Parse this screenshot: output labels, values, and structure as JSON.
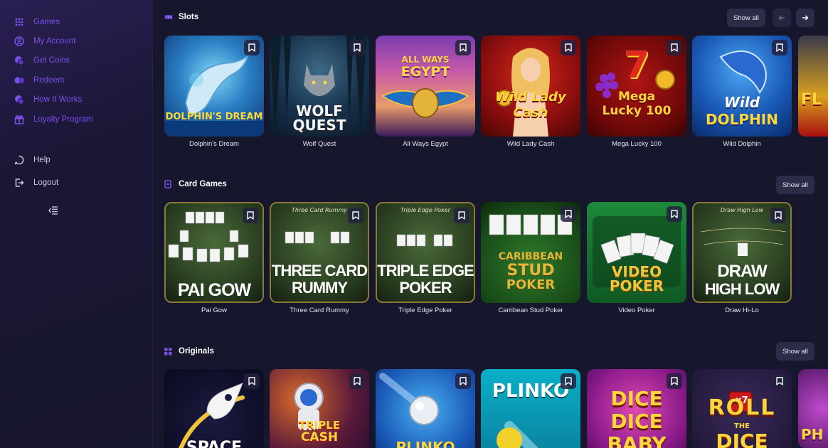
{
  "sidebar": {
    "items": [
      {
        "label": "Games",
        "icon": "grid-icon"
      },
      {
        "label": "My Account",
        "icon": "user-circle-icon"
      },
      {
        "label": "Get Coins",
        "icon": "coins-icon"
      },
      {
        "label": "Redeem",
        "icon": "redeem-icon"
      },
      {
        "label": "How It Works",
        "icon": "info-coins-icon"
      },
      {
        "label": "Loyalty Program",
        "icon": "gift-icon"
      }
    ],
    "help_label": "Help",
    "logout_label": "Logout"
  },
  "sections": {
    "slots": {
      "title": "Slots",
      "show_all": "Show all",
      "games": [
        {
          "name": "Dolphin's Dream",
          "art": "DOLPHIN'S DREAM"
        },
        {
          "name": "Wolf Quest",
          "art1": "WOLF",
          "art2": "QUEST"
        },
        {
          "name": "All Ways Egypt",
          "art1": "ALL WAYS",
          "art2": "EGYPT"
        },
        {
          "name": "Wild Lady Cash",
          "art1": "Wild Lady",
          "art2": "Cash"
        },
        {
          "name": "Mega Lucky 100",
          "art1": "7",
          "art2": "Mega",
          "art3": "Lucky 100"
        },
        {
          "name": "Wild Dolphin",
          "art1": "Wild",
          "art2": "DOLPHIN"
        }
      ],
      "partial_art": "FL"
    },
    "card_games": {
      "title": "Card Games",
      "show_all": "Show all",
      "games": [
        {
          "name": "Pai Gow",
          "art": "PAI GOW"
        },
        {
          "name": "Three Card Rummy",
          "art1": "THREE CARD",
          "art2": "RUMMY",
          "top": "Three Card Rummy"
        },
        {
          "name": "Triple Edge Poker",
          "art1": "TRIPLE EDGE",
          "art2": "POKER",
          "top": "Triple Edge Poker"
        },
        {
          "name": "Carribean Stud Poker",
          "art1": "CARIBBEAN",
          "art2": "STUD",
          "art3": "POKER"
        },
        {
          "name": "Video Poker",
          "art1": "VIDEO",
          "art2": "POKER"
        },
        {
          "name": "Draw Hi-Lo",
          "art1": "DRAW",
          "art2": "HIGH LOW",
          "top": "Draw High Low"
        }
      ]
    },
    "originals": {
      "title": "Originals",
      "show_all": "Show all",
      "games": [
        {
          "art": "SPACE"
        },
        {
          "art1": "TRIPLE",
          "art2": "CASH"
        },
        {
          "art": "PLINKO"
        },
        {
          "art": "PLINKO"
        },
        {
          "art1": "DICE",
          "art2": "DICE",
          "art3": "BABY"
        },
        {
          "art1": "ROLL",
          "art2": "THE",
          "art3": "DICE",
          "badge": "x7"
        }
      ],
      "partial_art": "PH"
    }
  },
  "colors": {
    "accent": "#7b4fe8",
    "bg": "#16162c",
    "sidebar": "#1a1736",
    "button": "#2c2b48"
  }
}
